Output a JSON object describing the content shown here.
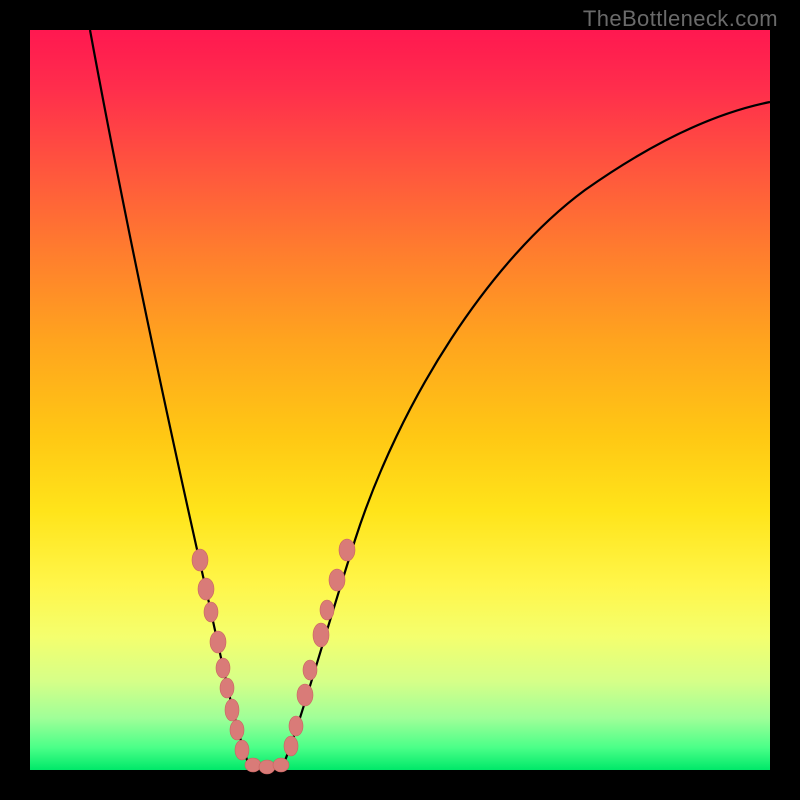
{
  "watermark": "TheBottleneck.com",
  "chart_data": {
    "type": "line",
    "title": "",
    "xlabel": "",
    "ylabel": "",
    "xlim": [
      0,
      100
    ],
    "ylim": [
      0,
      100
    ],
    "background_gradient": {
      "top": "#ff1850",
      "middle": "#ffe41a",
      "bottom": "#00e869",
      "meaning": "red high bottleneck to green low bottleneck"
    },
    "series": [
      {
        "name": "left-branch",
        "x": [
          8,
          12,
          16,
          20,
          24,
          28,
          30
        ],
        "y": [
          100,
          72,
          48,
          28,
          14,
          4,
          0
        ]
      },
      {
        "name": "valley-floor",
        "x": [
          30,
          32,
          34
        ],
        "y": [
          0,
          0,
          0
        ]
      },
      {
        "name": "right-branch",
        "x": [
          34,
          40,
          48,
          60,
          75,
          90,
          100
        ],
        "y": [
          0,
          18,
          40,
          62,
          78,
          86,
          90
        ]
      }
    ],
    "annotations": {
      "beads_left_branch": [
        {
          "x": 23,
          "y": 28
        },
        {
          "x": 24,
          "y": 24
        },
        {
          "x": 24.5,
          "y": 21
        },
        {
          "x": 25.5,
          "y": 17
        },
        {
          "x": 26,
          "y": 14
        },
        {
          "x": 26.5,
          "y": 11
        },
        {
          "x": 27.5,
          "y": 8
        },
        {
          "x": 28,
          "y": 5.5
        },
        {
          "x": 28.5,
          "y": 3
        }
      ],
      "beads_valley": [
        {
          "x": 30,
          "y": 0.5
        },
        {
          "x": 32,
          "y": 0
        },
        {
          "x": 34,
          "y": 0.5
        }
      ],
      "beads_right_branch": [
        {
          "x": 35,
          "y": 3
        },
        {
          "x": 36,
          "y": 6
        },
        {
          "x": 37,
          "y": 10
        },
        {
          "x": 38,
          "y": 13.5
        },
        {
          "x": 39,
          "y": 18
        },
        {
          "x": 40,
          "y": 21.5
        },
        {
          "x": 41.5,
          "y": 25.5
        },
        {
          "x": 43,
          "y": 29.5
        }
      ],
      "bead_color": "#d97b78"
    },
    "notes": "V-shaped bottleneck curve over a vertical red-to-green gradient. Minimum (0%) occurs near x≈31. Left branch descends very steeply from 100% toward x≈30; right branch rises more gently, asymptoting near ~90%. Beads mark sampled points on both sides of the minimum and along the valley floor."
  }
}
